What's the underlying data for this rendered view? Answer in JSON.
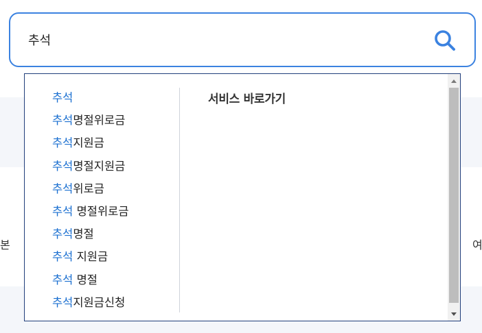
{
  "search": {
    "value": "추석",
    "icon": "search-icon",
    "accent_color": "#3b82e0"
  },
  "background": {
    "left_fragment": "본",
    "right_fragment": "여"
  },
  "dropdown": {
    "highlight_color": "#1a6fd0",
    "suggestions": [
      {
        "highlight": "추석",
        "rest": ""
      },
      {
        "highlight": "추석",
        "rest": "명절위로금"
      },
      {
        "highlight": "추석",
        "rest": "지원금"
      },
      {
        "highlight": "추석",
        "rest": "명절지원금"
      },
      {
        "highlight": "추석",
        "rest": "위로금"
      },
      {
        "highlight": "추석",
        "rest": " 명절위로금"
      },
      {
        "highlight": "추석",
        "rest": "명절"
      },
      {
        "highlight": "추석",
        "rest": " 지원금"
      },
      {
        "highlight": "추석",
        "rest": " 명절"
      },
      {
        "highlight": "추석",
        "rest": "지원금신청"
      }
    ],
    "service_title": "서비스 바로가기"
  }
}
